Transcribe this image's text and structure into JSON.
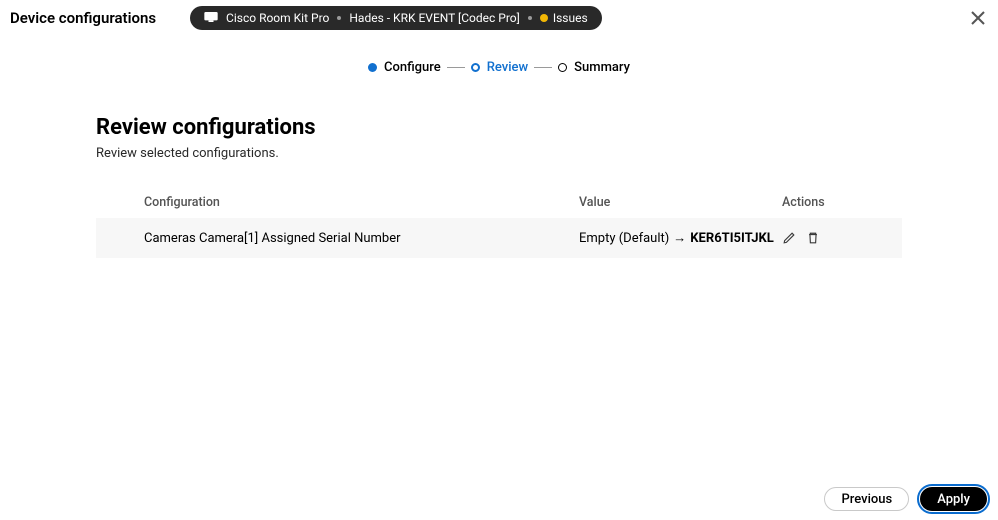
{
  "header": {
    "title": "Device configurations",
    "device_type": "Cisco Room Kit Pro",
    "device_name": "Hades - KRK EVENT [Codec Pro]",
    "issues_label": "Issues"
  },
  "stepper": {
    "steps": [
      {
        "label": "Configure",
        "state": "done"
      },
      {
        "label": "Review",
        "state": "current"
      },
      {
        "label": "Summary",
        "state": "pending"
      }
    ]
  },
  "section": {
    "title": "Review configurations",
    "subtitle": "Review selected configurations."
  },
  "table": {
    "columns": {
      "config": "Configuration",
      "value": "Value",
      "actions": "Actions"
    },
    "rows": [
      {
        "config": "Cameras Camera[1] Assigned Serial Number",
        "old_value": "Empty (Default)",
        "arrow": "→",
        "new_value": "KER6TI5ITJKL"
      }
    ]
  },
  "footer": {
    "previous": "Previous",
    "apply": "Apply"
  }
}
